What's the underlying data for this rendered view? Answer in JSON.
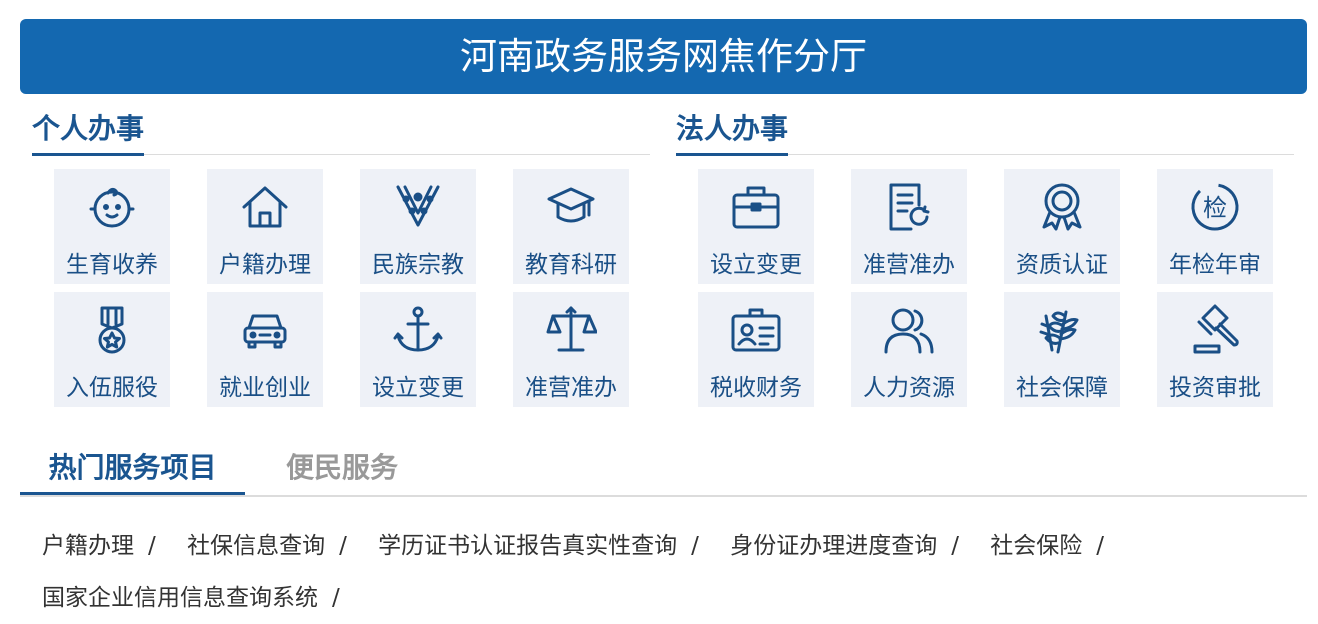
{
  "header": {
    "title": "河南政务服务网焦作分厅"
  },
  "personal": {
    "title": "个人办事",
    "items": [
      {
        "label": "生育收养",
        "icon": "baby-icon"
      },
      {
        "label": "户籍办理",
        "icon": "house-icon"
      },
      {
        "label": "民族宗教",
        "icon": "ethnic-collar-icon"
      },
      {
        "label": "教育科研",
        "icon": "graduation-cap-icon"
      },
      {
        "label": "入伍服役",
        "icon": "medal-icon"
      },
      {
        "label": "就业创业",
        "icon": "car-icon"
      },
      {
        "label": "设立变更",
        "icon": "anchor-icon"
      },
      {
        "label": "准营准办",
        "icon": "scales-icon"
      }
    ]
  },
  "legal": {
    "title": "法人办事",
    "items": [
      {
        "label": "设立变更",
        "icon": "briefcase-icon"
      },
      {
        "label": "准营准办",
        "icon": "document-refresh-icon"
      },
      {
        "label": "资质认证",
        "icon": "award-badge-icon"
      },
      {
        "label": "年检年审",
        "icon": "inspection-seal-icon",
        "glyph": "检"
      },
      {
        "label": "税收财务",
        "icon": "id-card-icon"
      },
      {
        "label": "人力资源",
        "icon": "people-icon"
      },
      {
        "label": "社会保障",
        "icon": "wheat-icon"
      },
      {
        "label": "投资审批",
        "icon": "gavel-icon"
      }
    ]
  },
  "tabs": [
    {
      "label": "热门服务项目",
      "active": true
    },
    {
      "label": "便民服务",
      "active": false
    }
  ],
  "hot_services": [
    "户籍办理",
    "社保信息查询",
    "学历证书认证报告真实性查询",
    "身份证办理进度查询",
    "社会保险",
    "国家企业信用信息查询系统"
  ],
  "separator": "/",
  "colors": {
    "banner": "#1468b0",
    "accent": "#1a5590",
    "tile_bg": "#eef1f7",
    "icon": "#1a4f86"
  }
}
